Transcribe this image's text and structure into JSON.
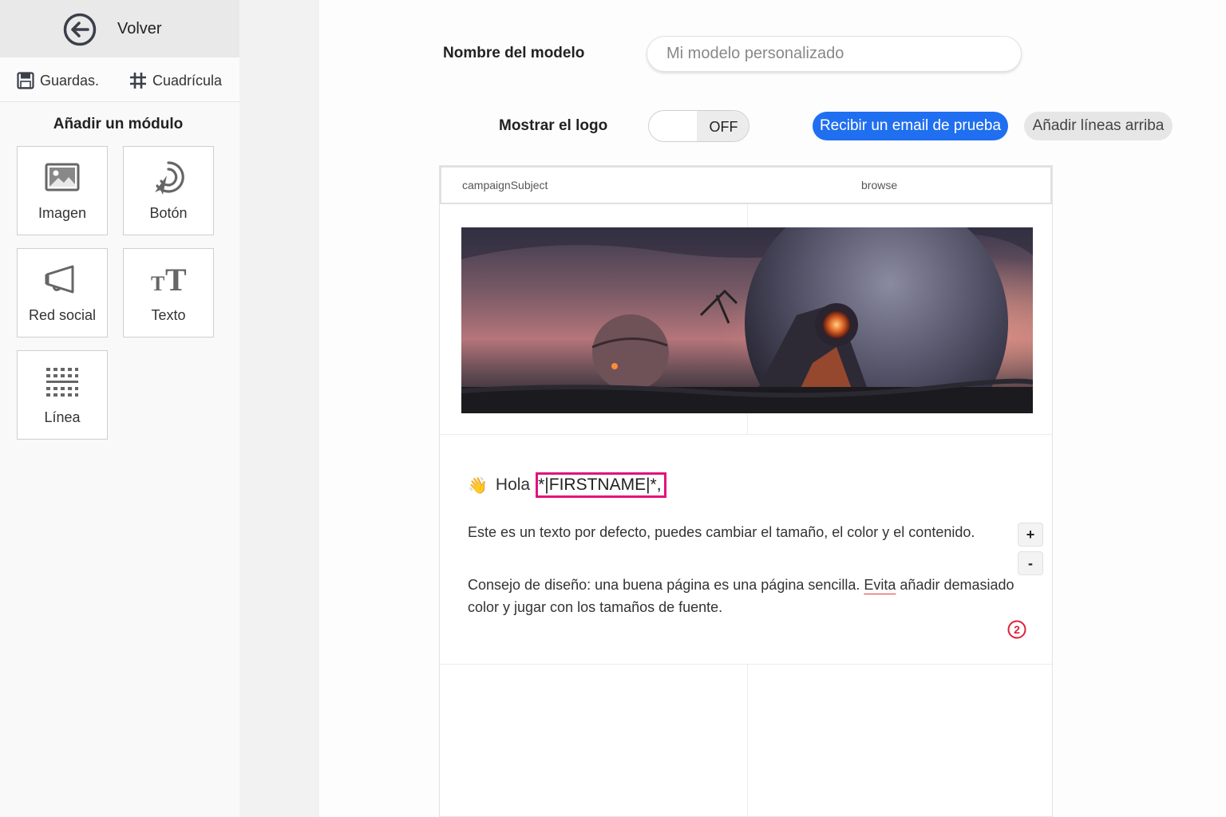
{
  "sidebar": {
    "back_label": "Volver",
    "toolbar": {
      "save_label": "Guardas.",
      "grid_label": "Cuadrícula"
    },
    "modules_title": "Añadir un módulo",
    "modules": [
      {
        "label": "Imagen",
        "icon": "image-icon"
      },
      {
        "label": "Botón",
        "icon": "button-click-icon"
      },
      {
        "label": "Red social",
        "icon": "megaphone-icon"
      },
      {
        "label": "Texto",
        "icon": "text-size-icon"
      },
      {
        "label": "Línea",
        "icon": "divider-line-icon"
      }
    ]
  },
  "header": {
    "model_name_label": "Nombre del modelo",
    "model_name_placeholder": "Mi modelo personalizado",
    "model_name_value": "",
    "show_logo_label": "Mostrar el logo",
    "logo_toggle_state": "OFF",
    "test_email_button": "Recibir un email de prueba",
    "add_lines_button": "Añadir líneas arriba"
  },
  "email": {
    "subject_placeholder": "campaignSubject",
    "browse_label": "browse",
    "greeting_emoji": "👋",
    "greeting_word": "Hola",
    "merge_tag": "*|FIRSTNAME|*,",
    "paragraph1": "Este es un texto por defecto, puedes cambiar el tamaño, el color y el contenido.",
    "paragraph2_before": "Consejo de diseño: una buena página es una página sencilla. ",
    "paragraph2_flagged_word": "Evita",
    "paragraph2_after": " añadir demasiado color y jugar con los tamaños de fuente.",
    "font_increase_label": "+",
    "font_decrease_label": "-",
    "step_badge": "2"
  },
  "colors": {
    "accent_blue": "#1f6ff0",
    "highlight_pink": "#e3127c",
    "badge_red": "#e0203a",
    "icon_gray": "#555555"
  }
}
